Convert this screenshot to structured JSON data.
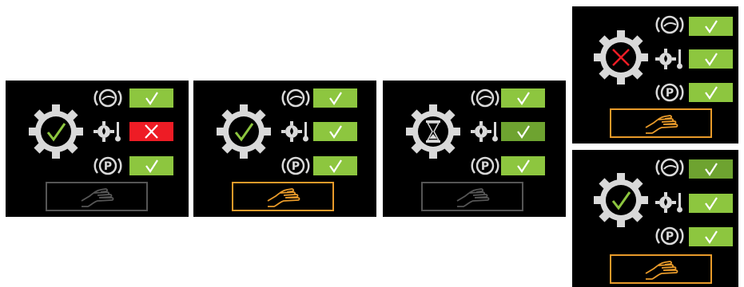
{
  "colors": {
    "ok": "#8dc63f",
    "ok_dim": "#6ea330",
    "error": "#ee1c25",
    "active": "#e89a2a",
    "inactive": "#555555",
    "icon": "#d9d9d9"
  },
  "panels": [
    {
      "id": "a",
      "gear": "check",
      "rows": {
        "brake": "check",
        "oil_temp": "cross",
        "park": "check"
      },
      "hand": "inactive"
    },
    {
      "id": "b",
      "gear": "check",
      "rows": {
        "brake": "check",
        "oil_temp": "check",
        "park": "check"
      },
      "hand": "active"
    },
    {
      "id": "c",
      "gear": "hourglass",
      "rows": {
        "brake": "check",
        "oil_temp": "check",
        "park": "check"
      },
      "hand": "inactive"
    },
    {
      "id": "d",
      "gear": "cross",
      "rows": {
        "brake": "check",
        "oil_temp": "check",
        "park": "check"
      },
      "hand": "active"
    },
    {
      "id": "e",
      "gear": "check",
      "rows": {
        "brake": "check",
        "oil_temp": "check",
        "park": "check"
      },
      "hand": "active"
    }
  ],
  "labels": {
    "park": "P"
  }
}
